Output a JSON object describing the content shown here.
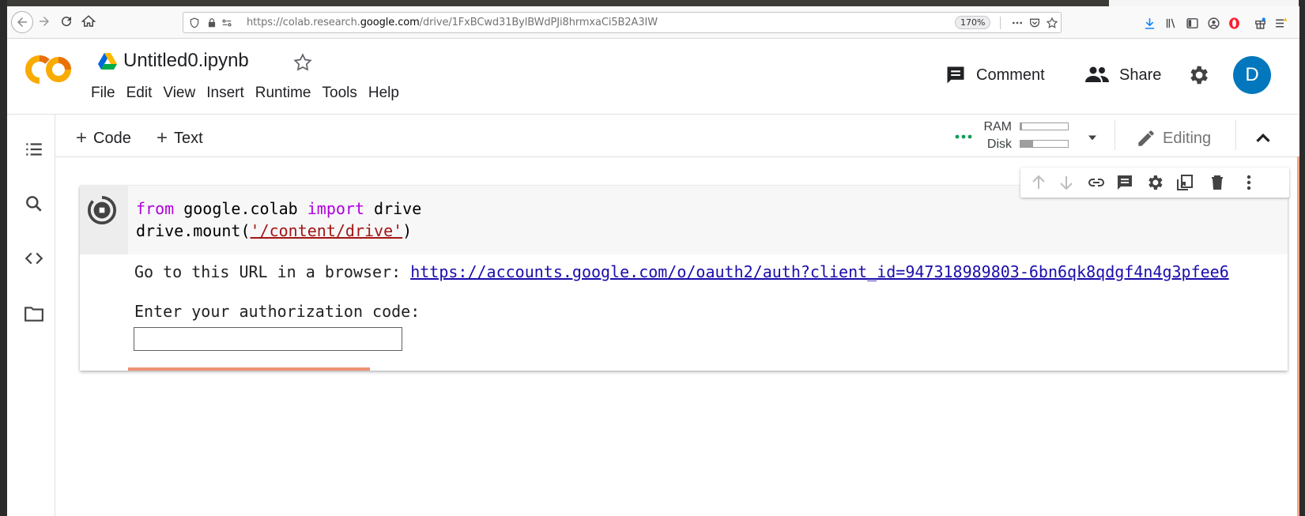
{
  "browser": {
    "url_prefix": "https://colab.research.",
    "url_domain": "google.com",
    "url_suffix": "/drive/1FxBCwd31BylBWdPJi8hrmxaCi5B2A3IW",
    "zoom": "170%"
  },
  "notebook": {
    "title": "Untitled0.ipynb"
  },
  "menu": [
    "File",
    "Edit",
    "View",
    "Insert",
    "Runtime",
    "Tools",
    "Help"
  ],
  "header": {
    "comment_label": "Comment",
    "share_label": "Share",
    "avatar_letter": "D",
    "avatar_color": "#0277bd"
  },
  "toolbar": {
    "add_code": "Code",
    "add_text": "Text",
    "ram_label": "RAM",
    "disk_label": "Disk",
    "ram_usage": 0.04,
    "disk_usage": 0.27,
    "editing_label": "Editing"
  },
  "cell": {
    "code_line1": {
      "kw1": "from",
      "mid": " google.colab ",
      "kw2": "import",
      "end": " drive"
    },
    "code_line2": {
      "pre": "drive.mount(",
      "str": "'/content/drive'",
      "post": ")"
    },
    "output_prefix": "Go to this URL in a browser: ",
    "output_url": "https://accounts.google.com/o/oauth2/auth?client_id=947318989803-6bn6qk8qdgf4n4g3pfee6",
    "auth_prompt": "Enter your authorization code:"
  },
  "colors": {
    "accent_orange": "#f9ab00",
    "progress": "#ee9175",
    "keyword": "#af00db",
    "string": "#a31515",
    "link": "#1a0dab"
  }
}
